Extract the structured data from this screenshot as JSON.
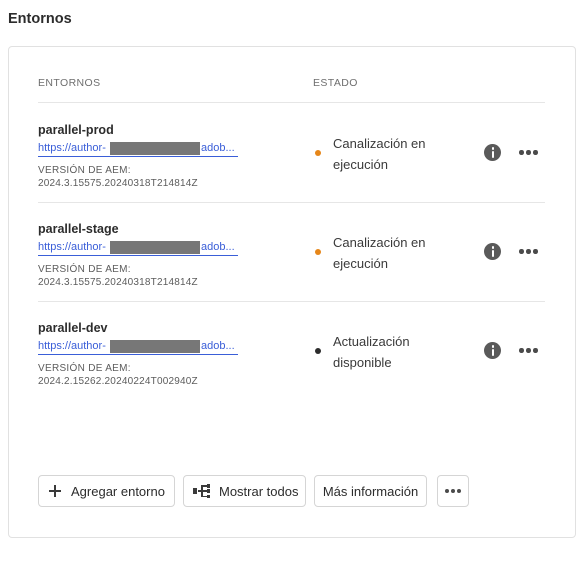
{
  "page": {
    "title": "Entornos"
  },
  "table": {
    "col_environments": "ENTORNOS",
    "col_status": "ESTADO",
    "aem_version_label": "VERSIÓN DE AEM:",
    "rows": [
      {
        "name": "parallel-prod",
        "link_prefix": "https://author-",
        "link_suffix": "adob...",
        "aem_version": "2024.3.15575.20240318T214814Z",
        "status": "Canalización en ejecución",
        "status_color": "#e68619"
      },
      {
        "name": "parallel-stage",
        "link_prefix": "https://author-",
        "link_suffix": "adob...",
        "aem_version": "2024.3.15575.20240318T214814Z",
        "status": "Canalización en ejecución",
        "status_color": "#e68619"
      },
      {
        "name": "parallel-dev",
        "link_prefix": "https://author-",
        "link_suffix": "adob...",
        "aem_version": "2024.2.15262.20240224T002940Z",
        "status": "Actualización disponible",
        "status_color": "#2c2c2c"
      }
    ]
  },
  "actions": {
    "add_env": "Agregar entorno",
    "show_all": "Mostrar todos",
    "more_info": "Más información"
  },
  "icons": {
    "info": "info-icon",
    "more": "more-actions-icon",
    "add": "plus-icon",
    "show_all": "tree-view-icon"
  }
}
